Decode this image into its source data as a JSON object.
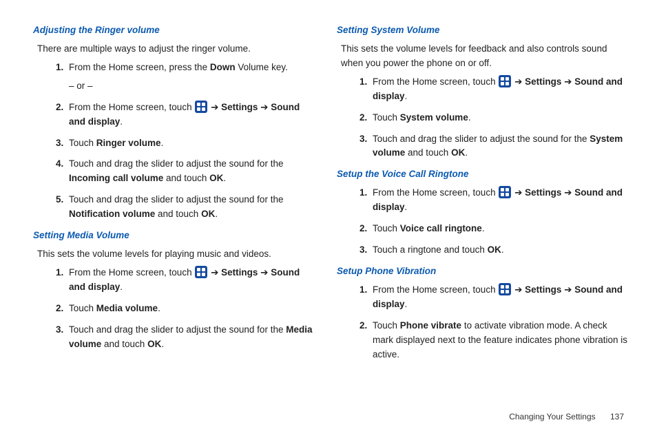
{
  "col_left": {
    "sec1": {
      "heading": "Adjusting the Ringer volume",
      "intro": "There are multiple ways to adjust the ringer volume.",
      "items": {
        "i1a": "From the Home screen, press the ",
        "i1b": "Down",
        "i1c": " Volume key.",
        "i1d": "– or –",
        "i2a": "From the Home screen, touch ",
        "i2b": " ➔ ",
        "i2c": "Settings",
        "i2d": " ➔ ",
        "i2e": "Sound and display",
        "i2f": ".",
        "i3a": "Touch ",
        "i3b": "Ringer volume",
        "i3c": ".",
        "i4a": "Touch and drag the slider to adjust the sound for the ",
        "i4b": "Incoming call volume",
        "i4c": " and touch ",
        "i4d": "OK",
        "i4e": ".",
        "i5a": "Touch and drag the slider to adjust the sound for the ",
        "i5b": "Notification volume",
        "i5c": " and touch ",
        "i5d": "OK",
        "i5e": "."
      }
    },
    "sec2": {
      "heading": "Setting Media Volume",
      "intro": "This sets the volume levels for playing music and videos.",
      "items": {
        "i1a": "From the Home screen, touch ",
        "i1b": " ➔ ",
        "i1c": "Settings",
        "i1d": " ➔ ",
        "i1e": "Sound and display",
        "i1f": ".",
        "i2a": "Touch ",
        "i2b": "Media volume",
        "i2c": ".",
        "i3a": "Touch and drag the slider to adjust the sound for the ",
        "i3b": "Media volume",
        "i3c": " and touch ",
        "i3d": "OK",
        "i3e": "."
      }
    }
  },
  "col_right": {
    "sec1": {
      "heading": "Setting System Volume",
      "intro": "This sets the volume levels for feedback and also controls sound when you power the phone on or off.",
      "items": {
        "i1a": "From the Home screen, touch ",
        "i1b": " ➔ ",
        "i1c": "Settings",
        "i1d": " ➔ ",
        "i1e": "Sound and display",
        "i1f": ".",
        "i2a": "Touch ",
        "i2b": "System volume",
        "i2c": ".",
        "i3a": "Touch and drag the slider to adjust the sound for the ",
        "i3b": "System volume",
        "i3c": " and touch ",
        "i3d": "OK",
        "i3e": "."
      }
    },
    "sec2": {
      "heading": "Setup the Voice Call Ringtone",
      "items": {
        "i1a": "From the Home screen, touch ",
        "i1b": " ➔ ",
        "i1c": "Settings",
        "i1d": " ➔ ",
        "i1e": "Sound and display",
        "i1f": ".",
        "i2a": "Touch ",
        "i2b": "Voice call ringtone",
        "i2c": ".",
        "i3a": "Touch a ringtone and touch ",
        "i3b": "OK",
        "i3c": "."
      }
    },
    "sec3": {
      "heading": "Setup Phone Vibration",
      "items": {
        "i1a": "From the Home screen, touch ",
        "i1b": " ➔ ",
        "i1c": "Settings",
        "i1d": " ➔ ",
        "i1e": "Sound and display",
        "i1f": ".",
        "i2a": "Touch ",
        "i2b": "Phone vibrate",
        "i2c": " to activate vibration mode. A check mark displayed next to the feature indicates phone vibration is active."
      }
    }
  },
  "footer": {
    "chapter": "Changing Your Settings",
    "page": "137"
  }
}
